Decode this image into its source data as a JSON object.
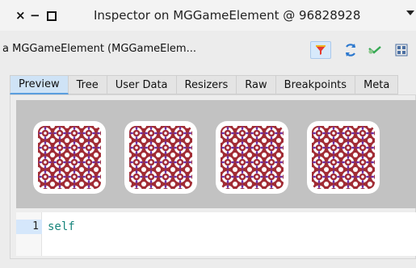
{
  "window": {
    "title": "Inspector on MGGameElement @ 96828928",
    "controls": {
      "close": "×",
      "minimize": "−",
      "maximize": "□"
    },
    "menu_icon": "chevron-down-icon"
  },
  "toolbar": {
    "object_label": "a MGGameElement (MGGameElem...",
    "icons": [
      "filter-icon",
      "refresh-icon",
      "browse-icon",
      "grid-icon"
    ],
    "accent_color": "#d7e9fb"
  },
  "tabs": [
    {
      "label": "Preview",
      "active": true
    },
    {
      "label": "Tree",
      "active": false
    },
    {
      "label": "User Data",
      "active": false
    },
    {
      "label": "Resizers",
      "active": false
    },
    {
      "label": "Raw",
      "active": false
    },
    {
      "label": "Breakpoints",
      "active": false
    },
    {
      "label": "Meta",
      "active": false
    }
  ],
  "preview": {
    "background_color": "#c2c2c2",
    "tiles": [
      {
        "pattern": "red-white-geometric-pattern"
      },
      {
        "pattern": "red-white-geometric-pattern"
      },
      {
        "pattern": "red-white-geometric-pattern"
      },
      {
        "pattern": "red-white-geometric-pattern"
      }
    ],
    "pattern_colors": {
      "primary": "#a12c34",
      "secondary": "#ffffff",
      "accent": "#6e2ea0"
    }
  },
  "editor": {
    "line_number": "1",
    "code": "self",
    "code_color": "#16847b"
  }
}
